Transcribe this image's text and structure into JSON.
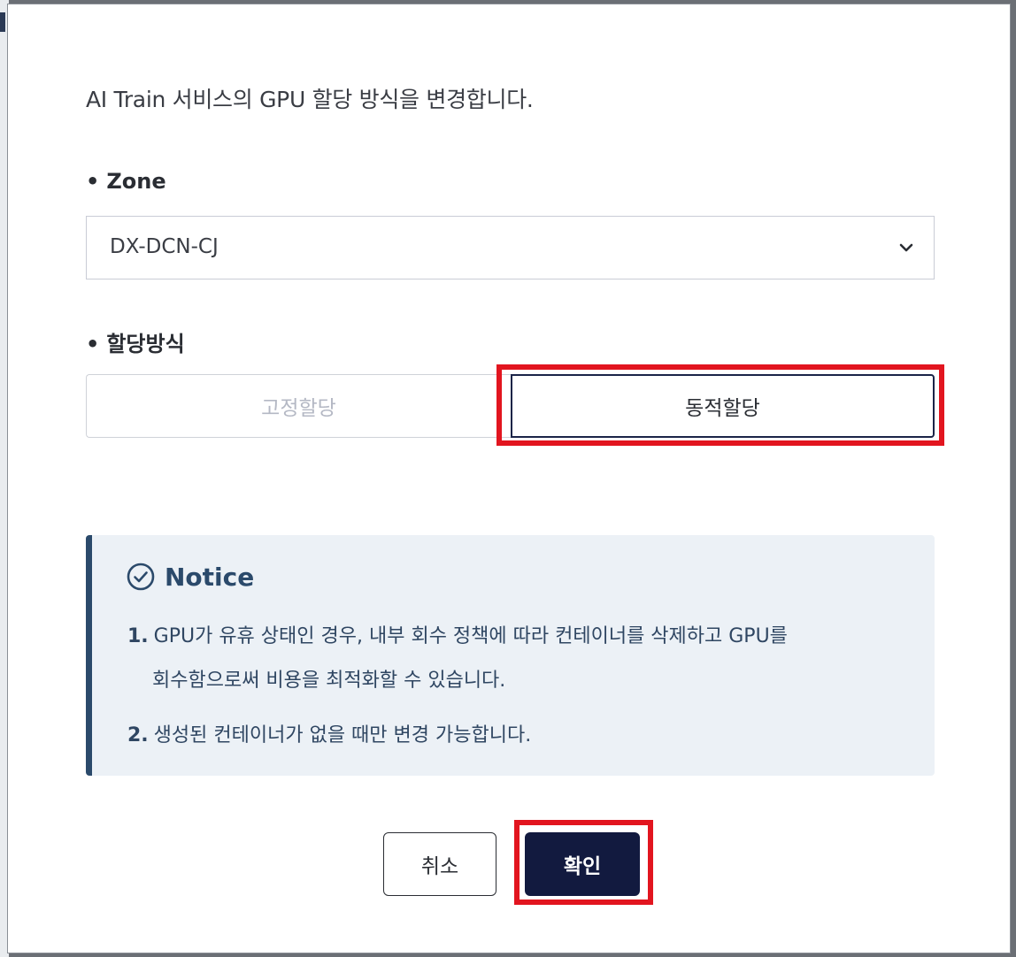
{
  "dialog": {
    "description": "AI Train 서비스의 GPU 할당 방식을 변경합니다."
  },
  "zone": {
    "bullet": "•",
    "label": "Zone",
    "selected": "DX-DCN-CJ",
    "chevron_icon": "chevron-down-icon"
  },
  "allocation": {
    "bullet": "•",
    "label": "할당방식",
    "options": [
      {
        "label": "고정할당",
        "selected": false
      },
      {
        "label": "동적할당",
        "selected": true
      }
    ]
  },
  "notice": {
    "icon": "check-circle-icon",
    "title": "Notice",
    "items": [
      {
        "number": "1.",
        "line1": "GPU가 유휴 상태인 경우, 내부 회수 정책에 따라 컨테이너를 삭제하고 GPU를",
        "line2": "회수함으로써 비용을 최적화할 수 있습니다."
      },
      {
        "number": "2.",
        "line1": "생성된 컨테이너가 없을 때만 변경 가능합니다."
      }
    ]
  },
  "buttons": {
    "cancel": "취소",
    "confirm": "확인"
  },
  "colors": {
    "highlight": "#e2151f",
    "primary": "#121a3f",
    "notice_accent": "#2b4a6b",
    "notice_bg": "#ecf1f6"
  }
}
